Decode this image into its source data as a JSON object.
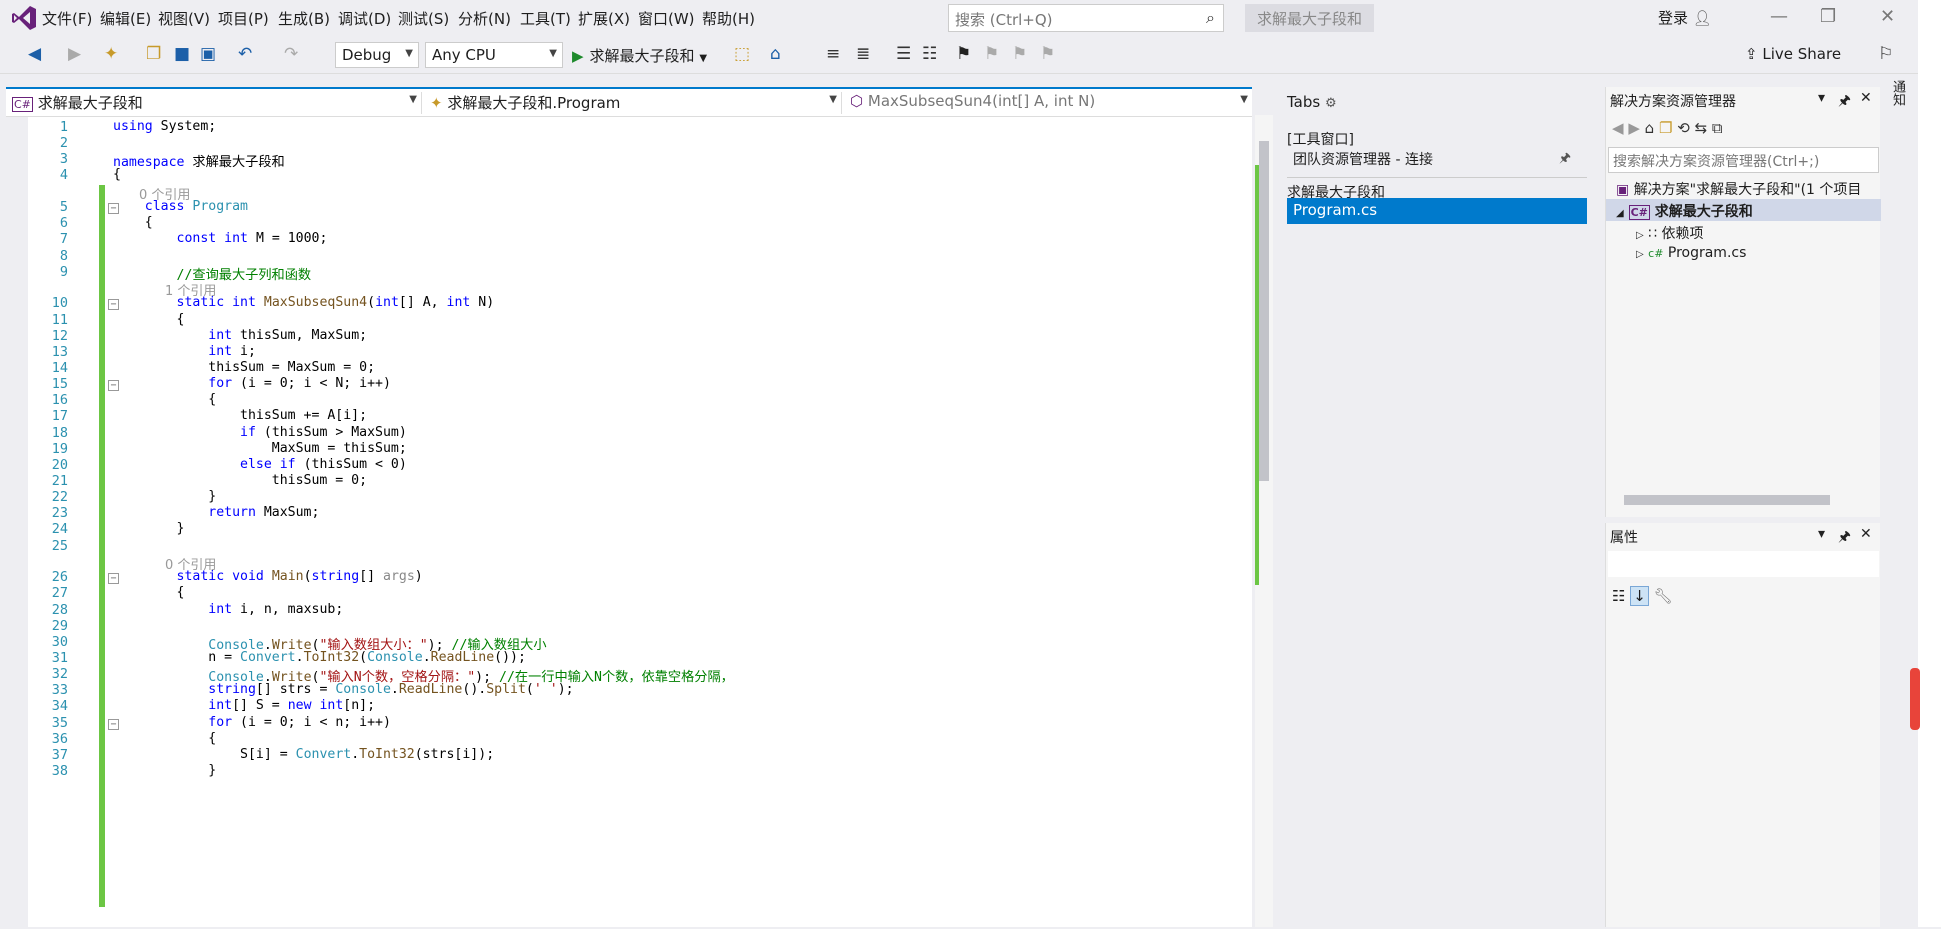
{
  "menu": {
    "items": [
      "文件(F)",
      "编辑(E)",
      "视图(V)",
      "项目(P)",
      "生成(B)",
      "调试(D)",
      "测试(S)",
      "分析(N)",
      "工具(T)",
      "扩展(X)",
      "窗口(W)",
      "帮助(H)"
    ],
    "search_placeholder": "搜索 (Ctrl+Q)",
    "solution_title": "求解最大子段和",
    "login": "登录"
  },
  "toolbar": {
    "config": "Debug",
    "platform": "Any CPU",
    "run_label": "求解最大子段和",
    "live_share": "Live Share"
  },
  "editor": {
    "nav_project": "求解最大子段和",
    "nav_class": "求解最大子段和.Program",
    "nav_member": "MaxSubseqSun4(int[] A, int N)",
    "lines": [
      {
        "n": "1",
        "ref": "",
        "html": "<span class='kw'>using</span> System;"
      },
      {
        "n": "2",
        "ref": "",
        "html": ""
      },
      {
        "n": "3",
        "ref": "",
        "html": "<span class='kw'>namespace</span> 求解最大子段和"
      },
      {
        "n": "4",
        "ref": "",
        "html": "{"
      },
      {
        "n": "5",
        "ref": "0 个引用",
        "html": "    <span class='kw'>class</span> <span class='ty'>Program</span>"
      },
      {
        "n": "6",
        "ref": "",
        "html": "    {"
      },
      {
        "n": "7",
        "ref": "",
        "html": "        <span class='kw'>const int</span> M = 1000;"
      },
      {
        "n": "8",
        "ref": "",
        "html": ""
      },
      {
        "n": "9",
        "ref": "",
        "html": "        <span class='cm'>//查询最大子列和函数</span>"
      },
      {
        "n": "10",
        "ref": "1 个引用",
        "html": "        <span class='kw'>static int</span> <span class='mt'>MaxSubseqSun4</span>(<span class='kw'>int</span>[] A, <span class='kw'>int</span> N)"
      },
      {
        "n": "11",
        "ref": "",
        "html": "        {"
      },
      {
        "n": "12",
        "ref": "",
        "html": "            <span class='kw'>int</span> thisSum, MaxSum;"
      },
      {
        "n": "13",
        "ref": "",
        "html": "            <span class='kw'>int</span> i;"
      },
      {
        "n": "14",
        "ref": "",
        "html": "            thisSum = MaxSum = 0;"
      },
      {
        "n": "15",
        "ref": "",
        "html": "            <span class='kw'>for</span> (i = 0; i &lt; N; i++)"
      },
      {
        "n": "16",
        "ref": "",
        "html": "            {"
      },
      {
        "n": "17",
        "ref": "",
        "html": "                thisSum += A[i];"
      },
      {
        "n": "18",
        "ref": "",
        "html": "                <span class='kw'>if</span> (thisSum &gt; MaxSum)"
      },
      {
        "n": "19",
        "ref": "",
        "html": "                    MaxSum = thisSum;"
      },
      {
        "n": "20",
        "ref": "",
        "html": "                <span class='kw'>else if</span> (thisSum &lt; 0)"
      },
      {
        "n": "21",
        "ref": "",
        "html": "                    thisSum = 0;"
      },
      {
        "n": "22",
        "ref": "",
        "html": "            }"
      },
      {
        "n": "23",
        "ref": "",
        "html": "            <span class='kw'>return</span> MaxSum;"
      },
      {
        "n": "24",
        "ref": "",
        "html": "        }"
      },
      {
        "n": "25",
        "ref": "",
        "html": ""
      },
      {
        "n": "26",
        "ref": "0 个引用",
        "html": "        <span class='kw'>static void</span> <span class='mt'>Main</span>(<span class='kw'>string</span>[] <span style='color:#888'>args</span>)"
      },
      {
        "n": "27",
        "ref": "",
        "html": "        {"
      },
      {
        "n": "28",
        "ref": "",
        "html": "            <span class='kw'>int</span> i, n, maxsub;"
      },
      {
        "n": "29",
        "ref": "",
        "html": ""
      },
      {
        "n": "30",
        "ref": "",
        "html": "            <span class='ty'>Console</span>.<span class='mt'>Write</span>(<span class='st'>\"输入数组大小：\"</span>); <span class='cm'>//输入数组大小</span>"
      },
      {
        "n": "31",
        "ref": "",
        "html": "            n = <span class='ty'>Convert</span>.<span class='mt'>ToInt32</span>(<span class='ty'>Console</span>.<span class='mt'>ReadLine</span>());"
      },
      {
        "n": "32",
        "ref": "",
        "html": "            <span class='ty'>Console</span>.<span class='mt'>Write</span>(<span class='st'>\"输入N个数，空格分隔：\"</span>); <span class='cm'>//在一行中输入N个数，依靠空格分隔，</span>"
      },
      {
        "n": "33",
        "ref": "",
        "html": "            <span class='kw'>string</span>[] strs = <span class='ty'>Console</span>.<span class='mt'>ReadLine</span>().<span class='mt'>Split</span>(<span class='st'>' '</span>);"
      },
      {
        "n": "34",
        "ref": "",
        "html": "            <span class='kw'>int</span>[] S = <span class='kw'>new int</span>[n];"
      },
      {
        "n": "35",
        "ref": "",
        "html": "            <span class='kw'>for</span> (i = 0; i &lt; n; i++)"
      },
      {
        "n": "36",
        "ref": "",
        "html": "            {"
      },
      {
        "n": "37",
        "ref": "",
        "html": "                S[i] = <span class='ty'>Convert</span>.<span class='mt'>ToInt32</span>(strs[i]);"
      },
      {
        "n": "38",
        "ref": "",
        "html": "            }"
      }
    ]
  },
  "tabs_pane": {
    "title": "Tabs",
    "tool_window": "[工具窗口]",
    "team_explorer": "团队资源管理器 - 连接",
    "project_group": "求解最大子段和",
    "selected_file": "Program.cs"
  },
  "solution_explorer": {
    "title": "解决方案资源管理器",
    "search_placeholder": "搜索解决方案资源管理器(Ctrl+;)",
    "solution_row": "解决方案\"求解最大子段和\"(1 个项目",
    "project_row": "求解最大子段和",
    "deps_row": "依赖项",
    "file_row": "Program.cs"
  },
  "properties": {
    "title": "属性"
  },
  "notifications": {
    "label": "通知"
  },
  "colors": {
    "accent": "#007acc",
    "change_bar": "#6cc644"
  }
}
